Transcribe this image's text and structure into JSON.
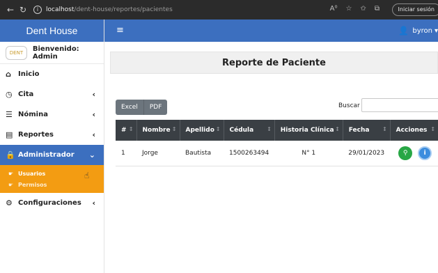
{
  "browser": {
    "back_icon": "←",
    "reload_icon": "↻",
    "info_icon": "i",
    "url_host": "localhost",
    "url_path": "/dent-house/reportes/pacientes",
    "icons": [
      "A⁰",
      "☆",
      "✩",
      "⧉"
    ],
    "signin_label": "Iniciar sesión"
  },
  "sidebar": {
    "brand": "Dent House",
    "logo_text": "DENT",
    "welcome": "Bienvenido: Admin",
    "items": [
      {
        "icon": "home-icon",
        "glyph": "⌂",
        "label": "Inicio",
        "chevron": ""
      },
      {
        "icon": "clock-icon",
        "glyph": "◷",
        "label": "Cita",
        "chevron": "‹"
      },
      {
        "icon": "list-icon",
        "glyph": "☰",
        "label": "Nómina",
        "chevron": "‹"
      },
      {
        "icon": "file-icon",
        "glyph": "▤",
        "label": "Reportes",
        "chevron": "‹"
      },
      {
        "icon": "lock-icon",
        "glyph": "🔒",
        "label": "Administrador",
        "chevron": "⌄"
      },
      {
        "icon": "gears-icon",
        "glyph": "⚙",
        "label": "Configuraciones",
        "chevron": "‹"
      }
    ],
    "submenu": [
      {
        "icon": "hand-point-icon",
        "glyph": "☛",
        "label": "Usuarios"
      },
      {
        "icon": "hand-point-icon",
        "glyph": "☛",
        "label": "Permisos"
      }
    ]
  },
  "topbar": {
    "menu_glyph": "≡",
    "user_glyph": "👤",
    "username": "byron",
    "caret": "▾"
  },
  "content": {
    "title": "Reporte de Paciente",
    "buttons": [
      "Excel",
      "PDF"
    ],
    "search_label": "Buscar",
    "search_value": "",
    "columns": [
      "#",
      "Nombre",
      "Apellido",
      "Cédula",
      "Historia Clínica",
      "Fecha",
      "Acciones"
    ],
    "rows": [
      {
        "num": "1",
        "nombre": "Jorge",
        "apellido": "Bautista",
        "cedula": "1500263494",
        "historia": "N° 1",
        "fecha": "29/01/2023"
      }
    ],
    "action_search_glyph": "⚲",
    "action_info_glyph": "i"
  },
  "colors": {
    "primary": "#3c6fbf",
    "submenu": "#f39c12",
    "table_header": "#3a3f44",
    "btn_gray": "#6c757d",
    "action_green": "#28a745",
    "action_blue": "#3c8dde"
  }
}
